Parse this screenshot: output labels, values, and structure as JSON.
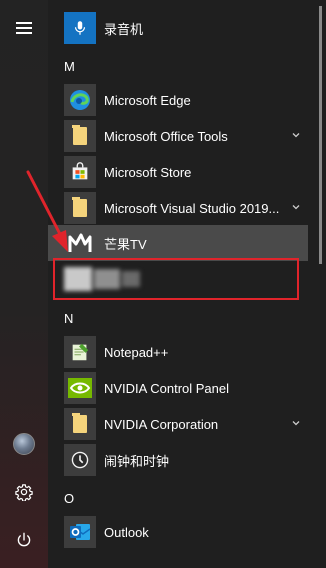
{
  "sections": {
    "M": "M",
    "N": "N",
    "O": "O"
  },
  "apps": {
    "recorder": "录音机",
    "edge": "Microsoft Edge",
    "office_tools": "Microsoft Office Tools",
    "store": "Microsoft Store",
    "visual_studio": "Microsoft Visual Studio 2019...",
    "mango_tv": "芒果TV",
    "notepadpp": "Notepad++",
    "nvidia_panel": "NVIDIA Control Panel",
    "nvidia_corp": "NVIDIA Corporation",
    "alarms": "闹钟和时钟",
    "outlook": "Outlook"
  },
  "icons": {
    "menu": "hamburger-menu-icon",
    "user": "user-avatar-icon",
    "settings": "gear-icon",
    "power": "power-icon"
  },
  "colors": {
    "annotation_red": "#e0242b",
    "folder_yellow": "#f5d47c",
    "background": "#1f1f1f"
  }
}
